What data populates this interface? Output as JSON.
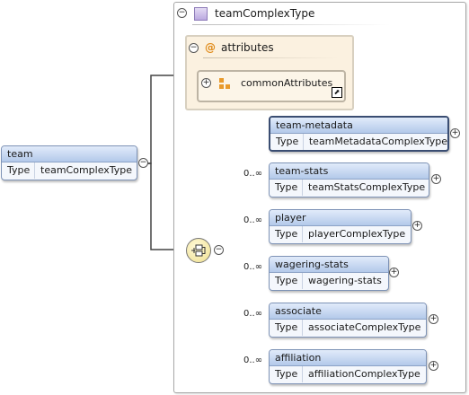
{
  "root_element": {
    "name": "team",
    "type_label": "Type",
    "type_value": "teamComplexType"
  },
  "complex_type": {
    "name": "teamComplexType",
    "attributes": {
      "at_symbol": "@",
      "label": "attributes",
      "group_ref": "commonAttributes"
    }
  },
  "sequence": [
    {
      "name": "team-metadata",
      "type_label": "Type",
      "type_value": "teamMetadataComplexType",
      "occurrence": "",
      "required": true
    },
    {
      "name": "team-stats",
      "type_label": "Type",
      "type_value": "teamStatsComplexType",
      "occurrence": "0..∞",
      "required": false
    },
    {
      "name": "player",
      "type_label": "Type",
      "type_value": "playerComplexType",
      "occurrence": "0..∞",
      "required": false
    },
    {
      "name": "wagering-stats",
      "type_label": "Type",
      "type_value": "wagering-stats",
      "occurrence": "0..∞",
      "required": false
    },
    {
      "name": "associate",
      "type_label": "Type",
      "type_value": "associateComplexType",
      "occurrence": "0..∞",
      "required": false
    },
    {
      "name": "affiliation",
      "type_label": "Type",
      "type_value": "affiliationComplexType",
      "occurrence": "0..∞",
      "required": false
    }
  ],
  "icons": {
    "collapse": "−",
    "expand": "+",
    "ref_arrow": "⬈"
  },
  "colors": {
    "element_header": "#b3c9ea",
    "element_border": "#7e93b6",
    "attributes_background": "#fbf1e0",
    "attribute_icon": "#e08b1a",
    "type_icon": "#bba9e0",
    "sequence_icon": "#efe08f"
  }
}
